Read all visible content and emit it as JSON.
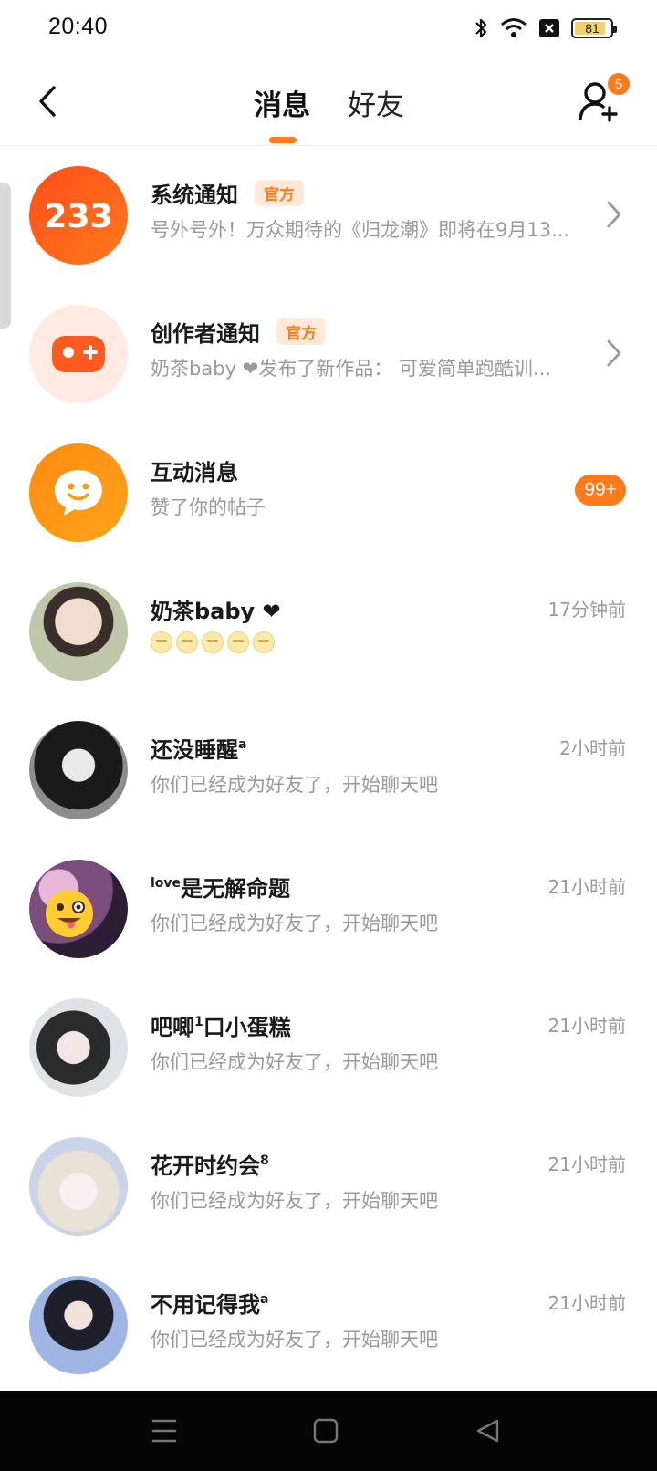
{
  "status_bar": {
    "time": "20:40",
    "battery": "81",
    "icons": [
      "bluetooth-icon",
      "wifi-icon",
      "notification-close-icon",
      "battery-icon"
    ]
  },
  "header": {
    "tabs": [
      {
        "label": "消息",
        "active": true
      },
      {
        "label": "好友",
        "active": false
      }
    ],
    "friend_request_count": "5",
    "accent_color": "#ff7a1a"
  },
  "system_rows": [
    {
      "title": "系统通知",
      "tag": "官方",
      "subtitle": "号外号外！万众期待的《归龙潮》即将在9月13...",
      "icon": "233-logo",
      "avatar_color": "#ff5a1f"
    },
    {
      "title": "创作者通知",
      "tag": "官方",
      "subtitle": "奶茶baby ❤发布了新作品：  可爱简单跑酷训...",
      "icon": "gamepad-icon",
      "avatar_color": "#ffe9e1"
    },
    {
      "title": "互动消息",
      "subtitle": "赞了你的帖子",
      "badge": "99+",
      "icon": "chat-bubble-icon",
      "avatar_color": "#ff9a10"
    }
  ],
  "conversations": [
    {
      "name": "奶茶baby ❤",
      "sup": "",
      "prefix_sup": "",
      "message": "",
      "emoji_count": 5,
      "time": "17分钟前"
    },
    {
      "name": "还没睡醒",
      "sup": "a",
      "prefix_sup": "",
      "message": "你们已经成为好友了，开始聊天吧",
      "time": "2小时前"
    },
    {
      "name": "是无解命题",
      "sup": "",
      "prefix_sup": "love",
      "message": "你们已经成为好友了，开始聊天吧",
      "time": "21小时前"
    },
    {
      "name": "吧唧",
      "sup": "1",
      "suffix": "口小蛋糕",
      "prefix_sup": "",
      "message": "你们已经成为好友了，开始聊天吧",
      "time": "21小时前"
    },
    {
      "name": "花开时约会",
      "sup": "8",
      "prefix_sup": "",
      "message": "你们已经成为好友了，开始聊天吧",
      "time": "21小时前"
    },
    {
      "name": "不用记得我",
      "sup": "a",
      "prefix_sup": "",
      "message": "你们已经成为好友了，开始聊天吧",
      "time": "21小时前"
    }
  ],
  "nav_bar": {
    "buttons": [
      "menu-icon",
      "home-icon",
      "back-triangle-icon"
    ]
  }
}
